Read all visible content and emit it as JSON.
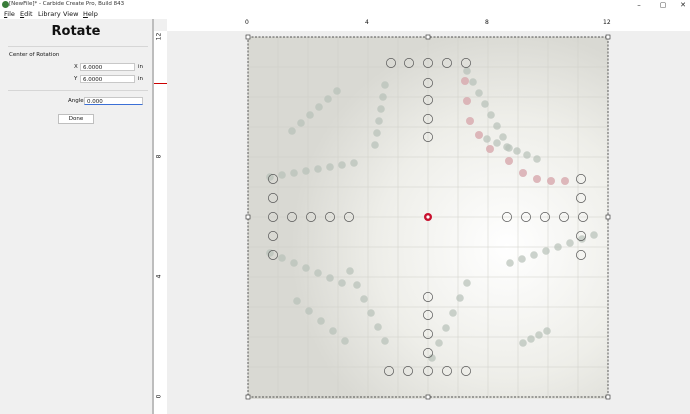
{
  "window": {
    "title": "[NewFile]* - Carbide Create Pro, Build 843",
    "minimize": "–",
    "maximize": "▢",
    "close": "✕"
  },
  "menu": [
    {
      "label": "File",
      "key": "F",
      "rest": "ile"
    },
    {
      "label": "Edit",
      "key": "E",
      "rest": "dit"
    },
    {
      "label": "Library",
      "key": "",
      "rest": "Library"
    },
    {
      "label": "View",
      "key": "",
      "rest": "View"
    },
    {
      "label": "Help",
      "key": "H",
      "rest": "elp"
    }
  ],
  "panel": {
    "title": "Rotate",
    "center_label": "Center of Rotation",
    "x_label": "X",
    "x_value": "6.0000",
    "y_label": "Y",
    "y_value": "6.0000",
    "unit": "in",
    "angle_label": "Angle",
    "angle_value": "0.000",
    "done_label": "Done"
  },
  "ruler": {
    "top_labels": [
      "0",
      "4",
      "8",
      "12"
    ],
    "left_labels": [
      "12",
      "8",
      "4",
      "0"
    ]
  },
  "colors": {
    "accent_red": "#c8102e",
    "selection": "#222222"
  }
}
